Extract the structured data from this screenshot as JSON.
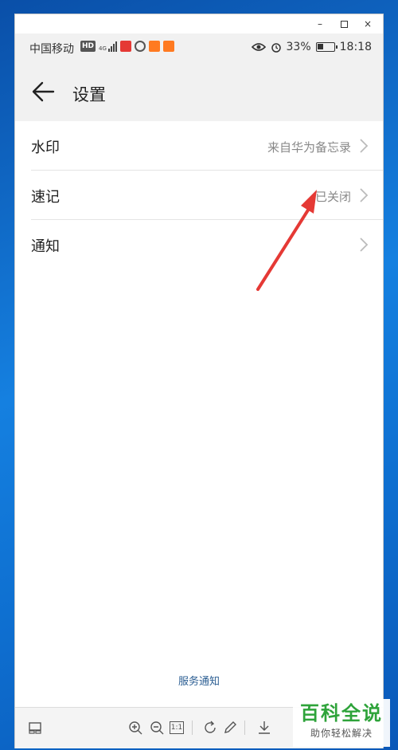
{
  "window": {
    "minimize": "–",
    "close": "×"
  },
  "statusbar": {
    "carrier": "中国移动",
    "hd": "HD",
    "network": "4G",
    "battery_percent": "33%",
    "time": "18:18",
    "battery_level": 0.33
  },
  "appbar": {
    "title": "设置"
  },
  "settings": [
    {
      "label": "水印",
      "value": "来自华为备忘录"
    },
    {
      "label": "速记",
      "value": "已关闭"
    },
    {
      "label": "通知",
      "value": ""
    }
  ],
  "footer": {
    "link": "服务通知"
  },
  "toolbar": {
    "zoom_in": "+",
    "zoom_out": "−",
    "actual_size": "1:1"
  },
  "watermark": {
    "title": "百科全说",
    "subtitle": "助你轻松解决"
  },
  "colors": {
    "accent_arrow": "#e53935",
    "watermark_green": "#2ea33a",
    "link_blue": "#2a5d92"
  }
}
